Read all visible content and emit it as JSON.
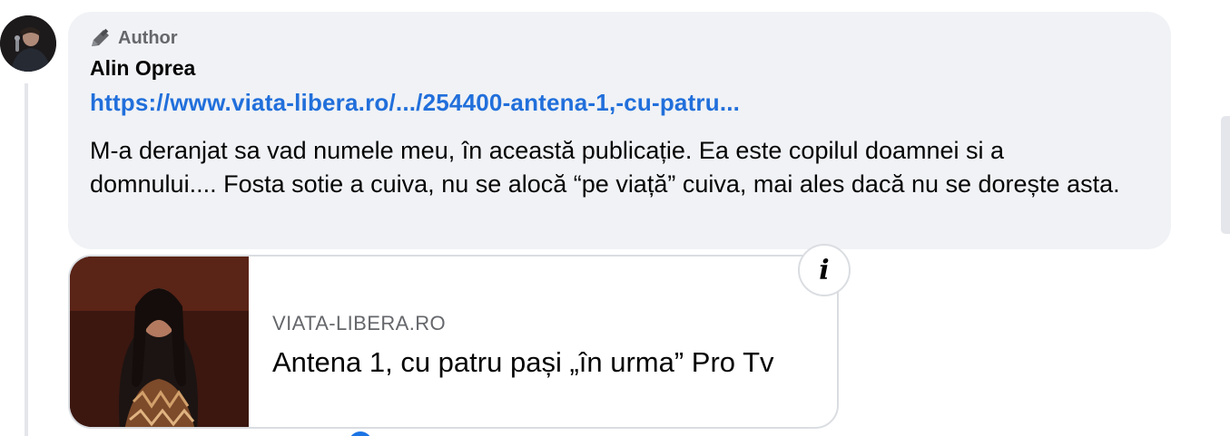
{
  "comment": {
    "badge_label": "Author",
    "author_name": "Alin Oprea",
    "link_text": "https://www.viata-libera.ro/.../254400-antena-1,-cu-patru...",
    "body": "M-a deranjat sa vad numele meu, în această publicație. Ea este copilul doamnei si a domnului.... Fosta sotie a cuiva, nu se alocă “pe viață” cuiva, mai ales dacă nu se dorește asta."
  },
  "preview": {
    "domain": "VIATA-LIBERA.RO",
    "title": "Antena 1, cu patru pași „în urma” Pro Tv",
    "info_icon": "i"
  },
  "icons": {
    "badge": "pen-icon",
    "info": "info-icon"
  },
  "colors": {
    "bubble_bg": "#f0f2f5",
    "link": "#216fdb",
    "secondary_text": "#65676b",
    "primary_text": "#050505"
  }
}
